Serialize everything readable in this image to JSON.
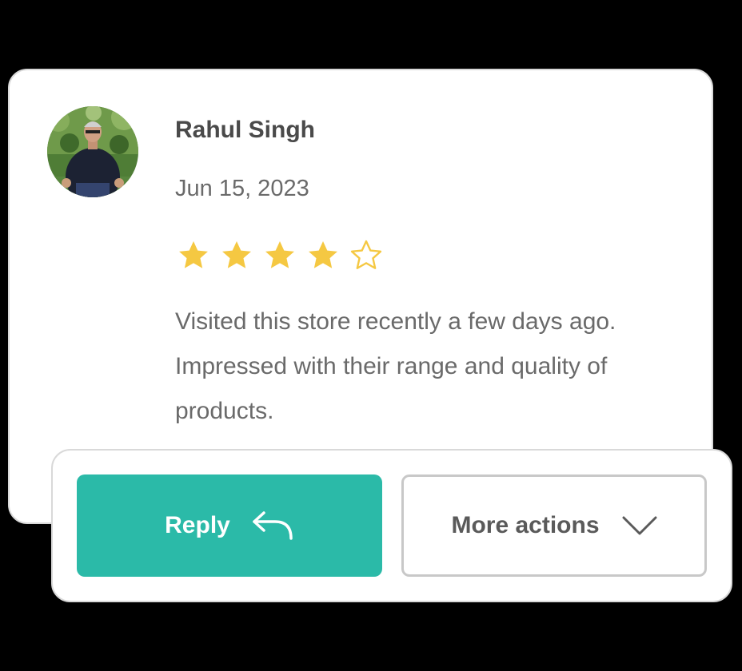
{
  "review": {
    "reviewer_name": "Rahul Singh",
    "date": "Jun 15, 2023",
    "rating": 4,
    "rating_max": 5,
    "text": "Visited this store recently a few days ago. Impressed with their range and quality of products."
  },
  "actions": {
    "reply_label": "Reply",
    "reply_icon": "reply-arrow-icon",
    "more_label": "More actions",
    "more_icon": "chevron-down-icon"
  },
  "colors": {
    "accent": "#2bbaa8",
    "star": "#f5c842",
    "background": "#000000"
  }
}
